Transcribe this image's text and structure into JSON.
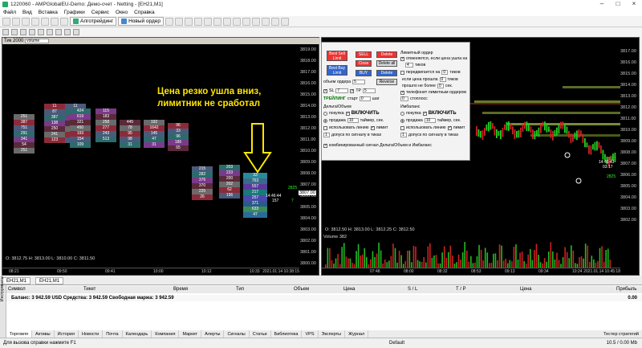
{
  "window": {
    "title": "1220060 - AMPGlobalEU-Demo: Демо-счет - Netting - [EH21,M1]"
  },
  "menu": [
    "Файл",
    "Вид",
    "Вставка",
    "Графики",
    "Сервис",
    "Окно",
    "Справка"
  ],
  "toolbar": {
    "algo_label": "Алготрейдинг",
    "new_order_label": "Новый ордер"
  },
  "chart1": {
    "header": "Тик 2000",
    "header_select": "volume",
    "prices": [
      "3819.00",
      "3818.00",
      "3817.00",
      "3816.00",
      "3815.00",
      "3814.00",
      "3813.00",
      "3812.00",
      "3811.00",
      "3810.00",
      "3809.00",
      "3808.00",
      "3807.00",
      "3806.00",
      "3805.00",
      "3804.00",
      "3803.00",
      "3802.00",
      "3801.00",
      "3800.00"
    ],
    "current_price": "3807.00",
    "timer": "14:46:44",
    "timer_sec": "157",
    "info": "O: 3812.75  H: 3813.00  L: 3810.00  C: 3811.50",
    "times": [
      "08:21",
      "09:50",
      "09:41",
      "10:00",
      "10:12",
      "10:33"
    ],
    "date": "2021.01.14 10:38:15",
    "note_line1": "Цена резко ушла вниз,",
    "note_line2": "лимитник не сработал",
    "green_nums": [
      "2825",
      "7"
    ],
    "columns": [
      {
        "cells": [
          "251",
          "387",
          "751",
          "291",
          "341",
          "54",
          "251"
        ]
      },
      {
        "cells": [
          "11",
          "87",
          "387",
          "138",
          "250",
          "241",
          "123"
        ]
      },
      {
        "cells": [
          "11",
          "230",
          "457",
          "301",
          "256",
          "154",
          "54"
        ]
      },
      {
        "cells": [
          "424",
          "619",
          "321",
          "450",
          "193",
          "154",
          "109"
        ]
      },
      {
        "cells": [
          "115",
          "183",
          "258",
          "277",
          "243",
          "513"
        ]
      },
      {
        "cells": [
          "445",
          "78",
          "95",
          "98",
          "31"
        ]
      },
      {
        "cells": [
          "192",
          "1642",
          "145",
          "47",
          "31"
        ]
      },
      {
        "cells": [
          "96",
          "33",
          "96",
          "186",
          "65"
        ]
      },
      {
        "cells": [
          "215",
          "282",
          "376",
          "370",
          "225",
          "26"
        ]
      },
      {
        "cells": [
          "203",
          "233",
          "200",
          "202",
          "62",
          "196"
        ]
      },
      {
        "cells": [
          "33",
          "763",
          "557",
          "217",
          "257",
          "371",
          "633",
          "47"
        ]
      }
    ]
  },
  "chart2": {
    "header": "EH21, Тик 2000",
    "prices": [
      "3817.00",
      "3816.00",
      "3815.00",
      "3814.00",
      "3813.00",
      "3812.00",
      "3811.00",
      "3810.00",
      "3809.00",
      "3808.00",
      "3807.00",
      "3806.00",
      "3805.00",
      "3804.00",
      "3803.00",
      "3802.00"
    ],
    "timer": "14:46:43",
    "timer_sec": "03:17",
    "info": "O: 3812.50  H: 3813.00  L: 3812.25  C: 3812.50",
    "volume_label": "Volume 382",
    "times": [
      "07:48",
      "08:00",
      "08:32",
      "08:53",
      "09:13",
      "09:34",
      "10:24"
    ],
    "date": "2021.01.14 10:45:18",
    "green_nums": [
      "2827",
      "2825"
    ]
  },
  "panel": {
    "best_sell": "Best Sell\nLimit 3807.2",
    "sell": "SELL",
    "delete": "Delete",
    "close": "Close",
    "delete_all": "Delete all",
    "best_buy": "Best Buy\nLimit 3807.0",
    "buy": "BUY",
    "order_volume_label": "объем ордера",
    "order_volume": "5",
    "reverse": "Reverse",
    "sl_label": "SL",
    "sl_val": "7",
    "tp_label": "TP",
    "tp_val": "5",
    "trailing_label": "ТРЕЙЛИНГ",
    "trailing_start": "старт",
    "trailing_start_val": "0",
    "trailing_step": "шаг",
    "limit_order_label": "Лимитный ордер",
    "limit_cancel": "отменяется, если цена ушла на",
    "limit_cancel_val": "4",
    "ticks_label": "тиков",
    "moves_label": "передвигается на",
    "moves_val": "0",
    "ticks2": "тиков",
    "if_price": "если цена прошла",
    "if_price_val": "0",
    "ticks3": "тиков",
    "passed_more": "прошло не более",
    "passed_val": "0",
    "sec_label": "сек.",
    "phone_label": "телефонит лимитным ордером",
    "stop_label": "стоплосс",
    "stop_val": "0",
    "delta_label": "Дельта/Объем",
    "delta_buy": "покупка",
    "enable1": "ВКЛЮЧИТЬ",
    "delta_sell": "продажа",
    "delta_val": "10",
    "timer_sec": "таймер, сек.",
    "use_line": "использовать линию",
    "limit": "лимит",
    "limit_by_signal": "допуск по сигналу в тиках",
    "limit_by_val": "1",
    "imbalance_label": "Имбаланс",
    "imb_buy": "покупка",
    "enable2": "ВКЛЮЧИТЬ",
    "imb_sell": "продажа",
    "imb_val": "10",
    "imb_timer": "таймер, сек.",
    "imb_use_line": "использовать линию",
    "imb_limit": "лимит",
    "imb_limit_by": "допуск по сигналу в тиках",
    "imb_limit_by_val": "1",
    "combined": "комбинированный сигнал Дельта/Объем и Имбаланс"
  },
  "chart_tabs": [
    "EH21,M1",
    "EH21,M1"
  ],
  "toolbox": {
    "headers": [
      "Символ",
      "Тикет",
      "Время",
      "Тип",
      "Объем",
      "Цена",
      "S / L",
      "T / P",
      "Цена",
      "Прибыль"
    ],
    "balance": "Баланс: 3 942.59 USD  Средства: 3 942.59  Свободная маржа: 3 942.59",
    "profit": "0.00",
    "side_label": "Инструменты",
    "tabs": [
      "Торговля",
      "Активы",
      "История",
      "Новости",
      "Почта",
      "Календарь",
      "Компания",
      "Маркет",
      "Алерты",
      "Сигналы",
      "Статьи",
      "Библиотека",
      "VPS",
      "Эксперты",
      "Журнал"
    ],
    "tester": "Тестер стратегий"
  },
  "status": {
    "help": "Для вызова справки нажмите F1",
    "profile": "Default",
    "traffic": "10.5 / 0.00 Mb"
  }
}
